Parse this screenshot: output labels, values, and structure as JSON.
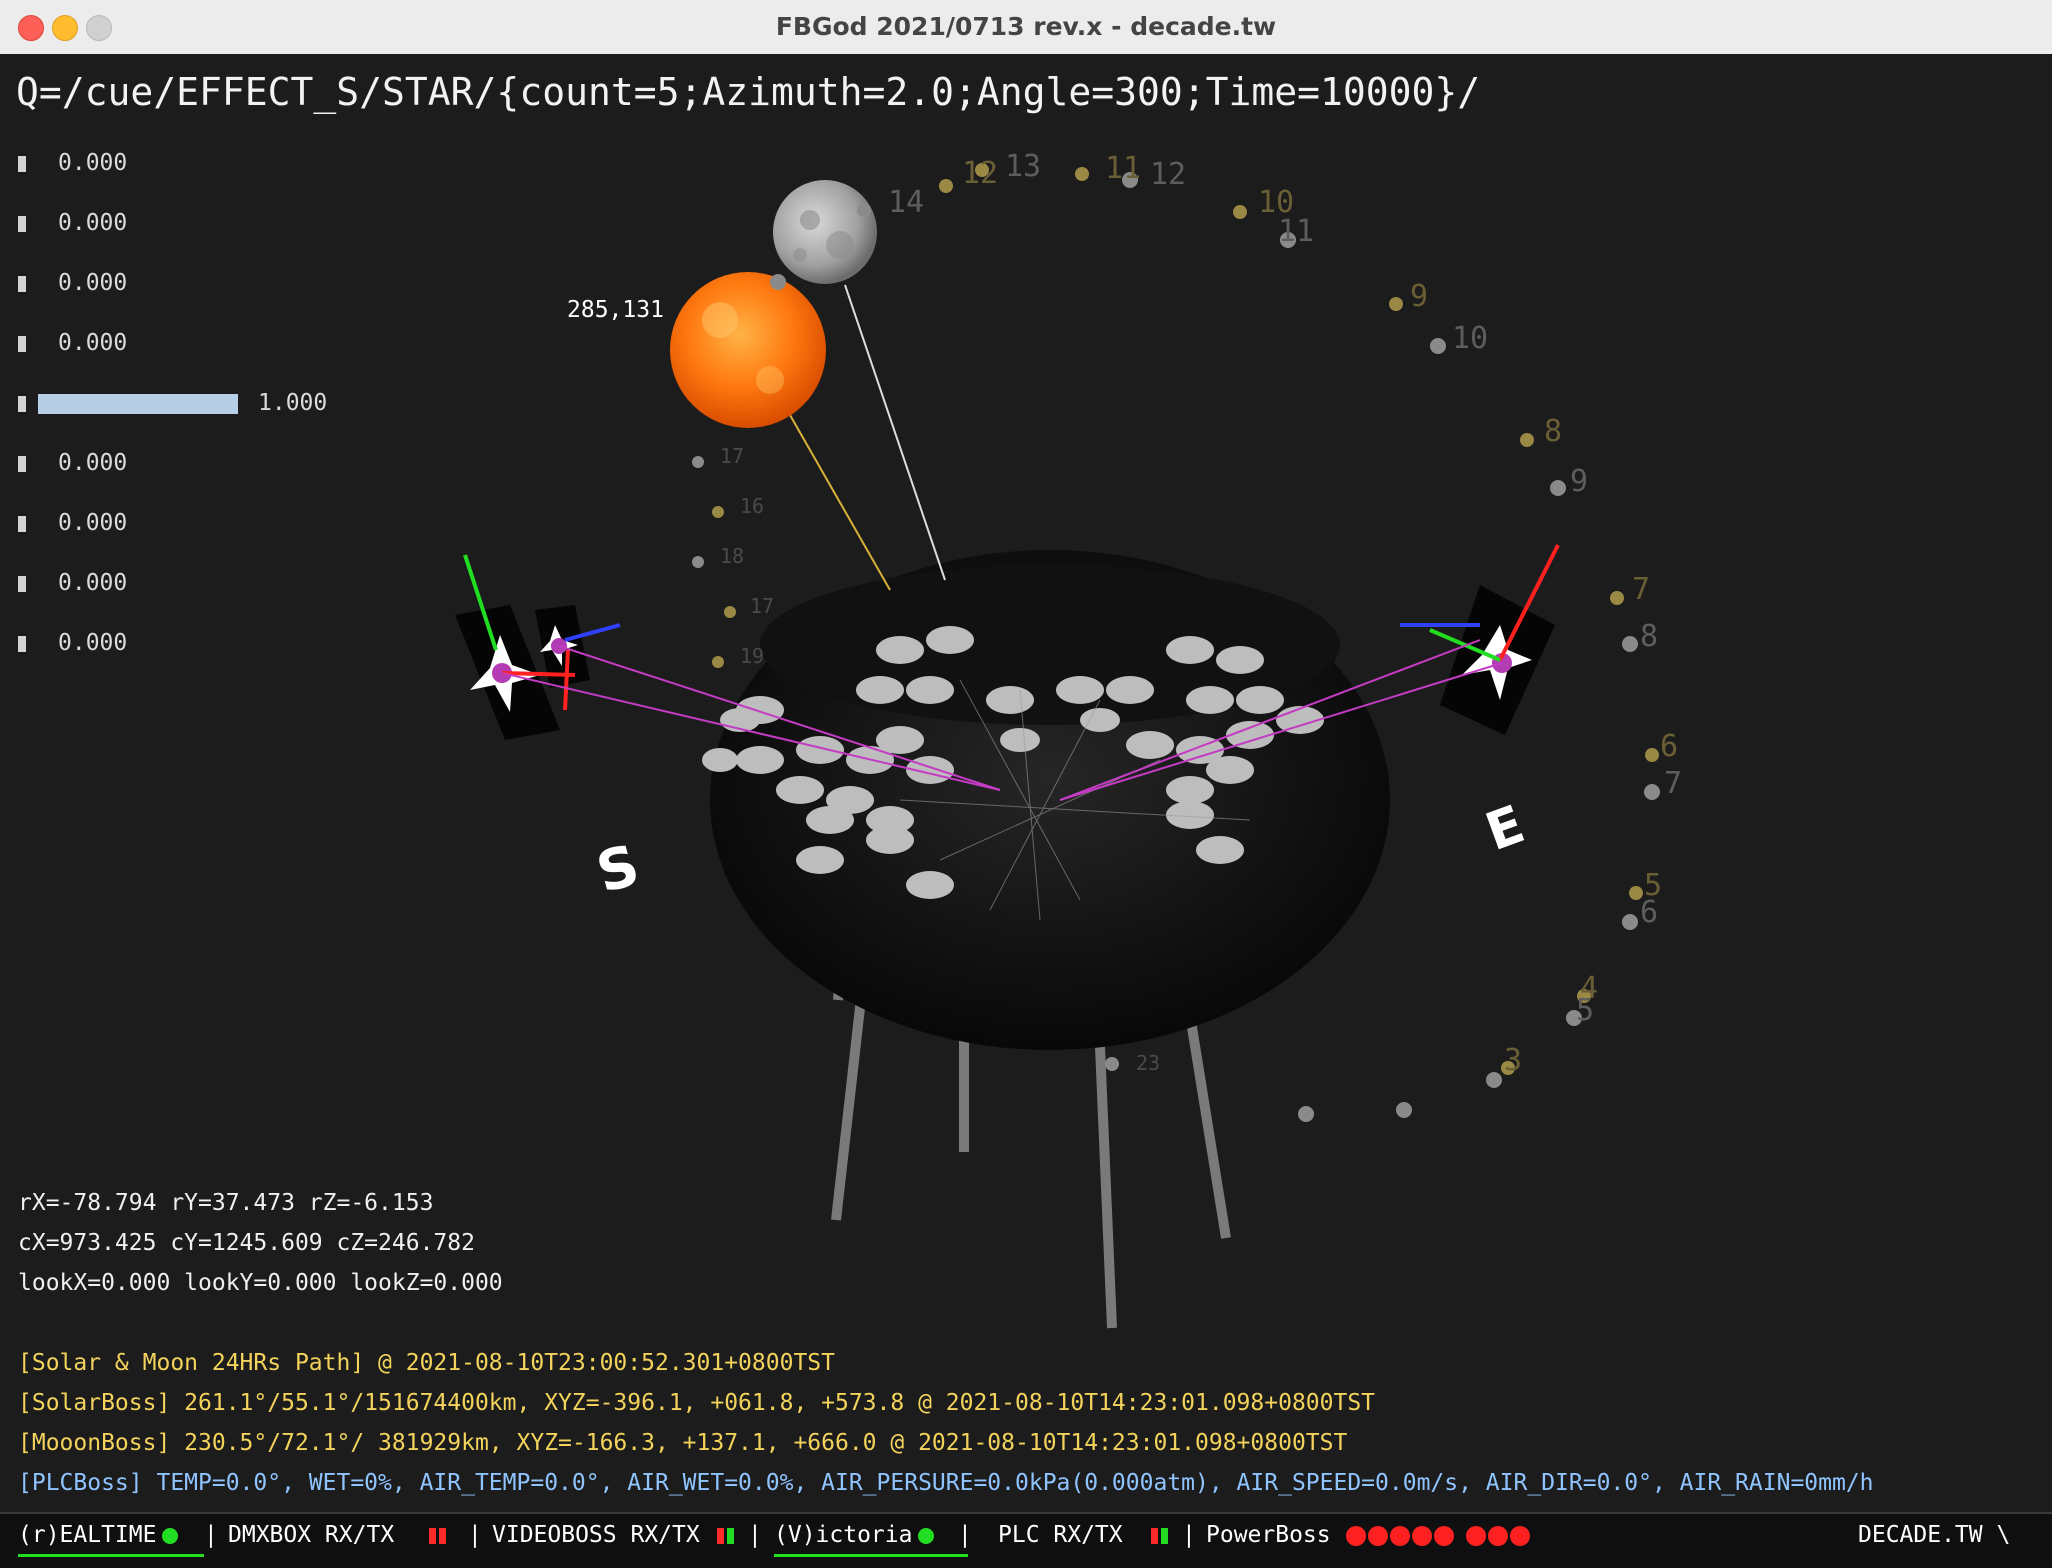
{
  "window": {
    "title": "FBGod 2021/0713 rev.x - decade.tw"
  },
  "command_line": "Q=/cue/EFFECT_S/STAR/{count=5;Azimuth=2.0;Angle=300;Time=10000}/",
  "meters": [
    {
      "value": "0.000",
      "level": 0
    },
    {
      "value": "0.000",
      "level": 0
    },
    {
      "value": "0.000",
      "level": 0
    },
    {
      "value": "0.000",
      "level": 0
    },
    {
      "value": "1.000",
      "level": 1
    },
    {
      "value": "0.000",
      "level": 0
    },
    {
      "value": "0.000",
      "level": 0
    },
    {
      "value": "0.000",
      "level": 0
    },
    {
      "value": "0.000",
      "level": 0
    }
  ],
  "scene": {
    "sun_label": "285,131",
    "compass_s": "S",
    "compass_e": "E",
    "sun_icon": "sun-icon",
    "moon_icon": "moon-icon",
    "path_labels": [
      "14",
      "13",
      "12",
      "13",
      "11",
      "12",
      "10",
      "11",
      "9",
      "10",
      "8",
      "9",
      "7",
      "8",
      "6",
      "7",
      "5",
      "6",
      "4",
      "5",
      "3",
      "17",
      "16",
      "18",
      "17",
      "19",
      "23"
    ]
  },
  "camera": {
    "rotation": "rX=-78.794 rY=37.473 rZ=-6.153",
    "position": "cX=973.425 cY=1245.609 cZ=246.782",
    "look": "lookX=0.000 lookY=0.000 lookZ=0.000"
  },
  "log": {
    "path_line": "[Solar & Moon 24HRs Path]  @ 2021-08-10T23:00:52.301+0800TST",
    "solar_line": "[SolarBoss] 261.1°/55.1°/151674400km, XYZ=-396.1, +061.8, +573.8  @ 2021-08-10T14:23:01.098+0800TST",
    "moon_line": "[MooonBoss] 230.5°/72.1°/   381929km, XYZ=-166.3, +137.1, +666.0  @ 2021-08-10T14:23:01.098+0800TST",
    "plc_line": "[PLCBoss] TEMP=0.0°, WET=0%, AIR_TEMP=0.0°, AIR_WET=0.0%, AIR_PERSURE=0.0kPa(0.000atm), AIR_SPEED=0.0m/s, AIR_DIR=0.0°, AIR_RAIN=0mm/h"
  },
  "colors": {
    "log_yellow": "#f3d35b",
    "log_blue": "#8fc4ff",
    "ok_green": "#22dd22",
    "alert_red": "#ff2020"
  },
  "status": {
    "realtime": "(r)EALTIME",
    "dmx": "DMXBOX RX/TX",
    "video": "VIDEOBOSS RX/TX",
    "victoria": "(V)ictoria",
    "plc": "PLC RX/TX",
    "power": "PowerBoss",
    "brand": "DECADE.TW \\",
    "sep": "|"
  }
}
